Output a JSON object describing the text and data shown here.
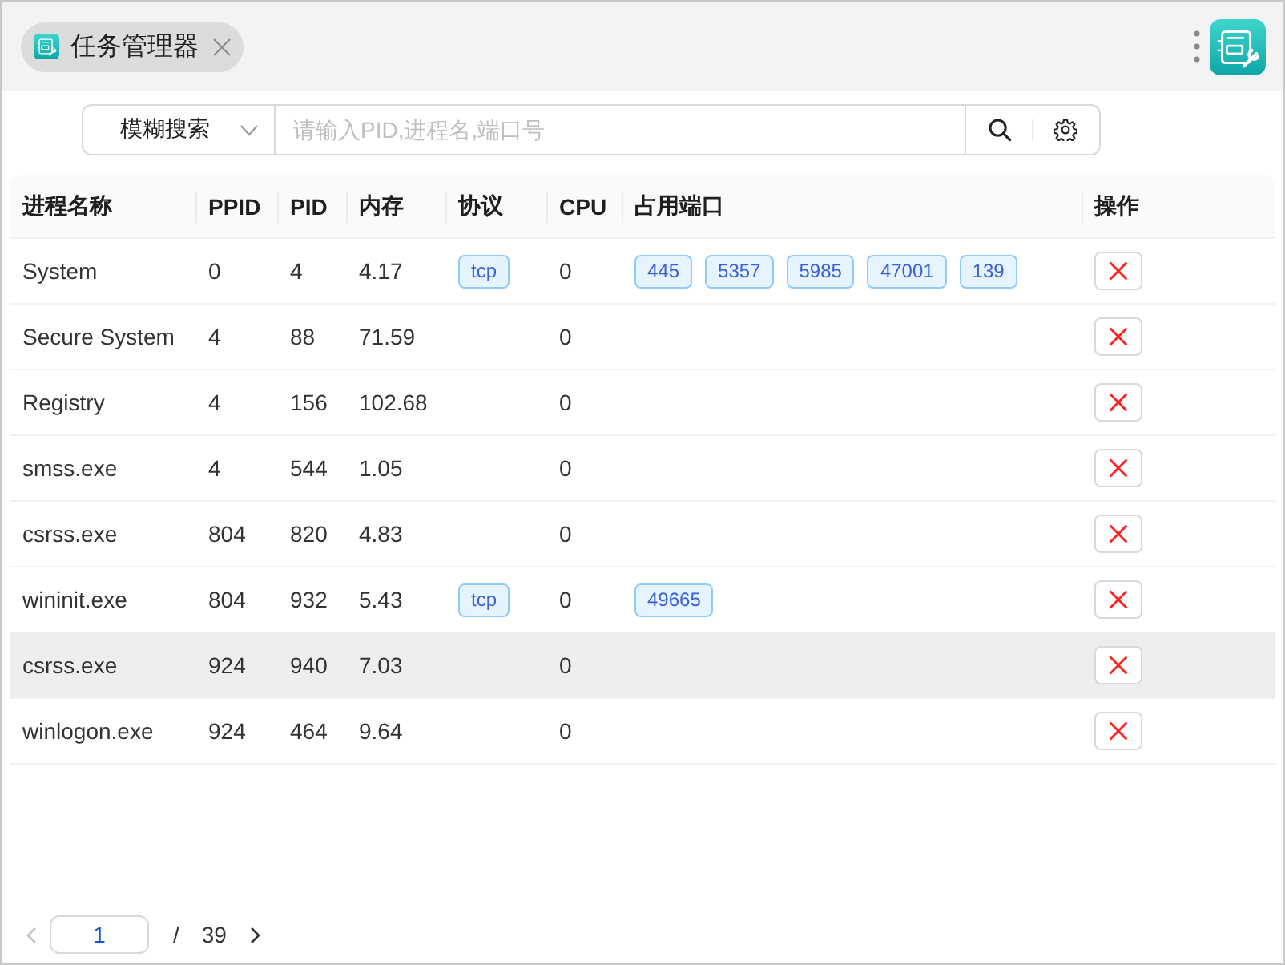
{
  "tab": {
    "title": "任务管理器"
  },
  "search": {
    "mode": "模糊搜索",
    "placeholder": "请输入PID,进程名,端口号"
  },
  "table": {
    "columns": [
      "进程名称",
      "PPID",
      "PID",
      "内存",
      "协议",
      "CPU",
      "占用端口",
      "操作"
    ],
    "rows": [
      {
        "name": "System",
        "ppid": "0",
        "pid": "4",
        "memory": "4.17",
        "protocols": [
          "tcp"
        ],
        "cpu": "0",
        "ports": [
          "445",
          "5357",
          "5985",
          "47001",
          "139"
        ],
        "hovered": false
      },
      {
        "name": "Secure System",
        "ppid": "4",
        "pid": "88",
        "memory": "71.59",
        "protocols": [],
        "cpu": "0",
        "ports": [],
        "hovered": false
      },
      {
        "name": "Registry",
        "ppid": "4",
        "pid": "156",
        "memory": "102.68",
        "protocols": [],
        "cpu": "0",
        "ports": [],
        "hovered": false
      },
      {
        "name": "smss.exe",
        "ppid": "4",
        "pid": "544",
        "memory": "1.05",
        "protocols": [],
        "cpu": "0",
        "ports": [],
        "hovered": false
      },
      {
        "name": "csrss.exe",
        "ppid": "804",
        "pid": "820",
        "memory": "4.83",
        "protocols": [],
        "cpu": "0",
        "ports": [],
        "hovered": false
      },
      {
        "name": "wininit.exe",
        "ppid": "804",
        "pid": "932",
        "memory": "5.43",
        "protocols": [
          "tcp"
        ],
        "cpu": "0",
        "ports": [
          "49665"
        ],
        "hovered": false
      },
      {
        "name": "csrss.exe",
        "ppid": "924",
        "pid": "940",
        "memory": "7.03",
        "protocols": [],
        "cpu": "0",
        "ports": [],
        "hovered": true
      },
      {
        "name": "winlogon.exe",
        "ppid": "924",
        "pid": "464",
        "memory": "9.64",
        "protocols": [],
        "cpu": "0",
        "ports": [],
        "hovered": false
      }
    ]
  },
  "pagination": {
    "prev": {
      "disabled": true
    },
    "page": "1",
    "separator": "/",
    "total": "39",
    "next": {
      "disabled": false
    }
  }
}
